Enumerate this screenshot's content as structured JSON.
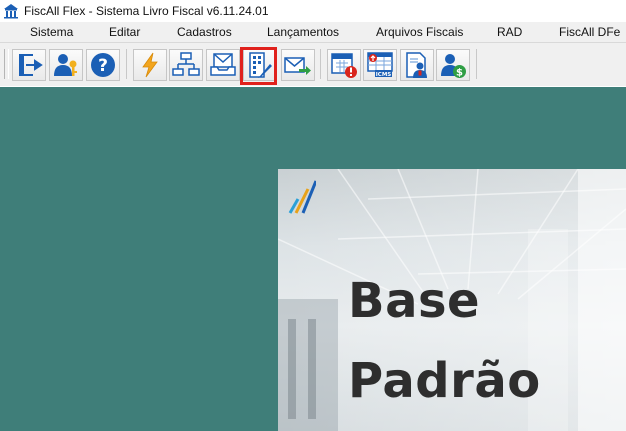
{
  "window": {
    "title": "FiscAll Flex - Sistema Livro Fiscal v6.11.24.01",
    "icon": "building-icon"
  },
  "menu": {
    "items": [
      {
        "label": "Sistema"
      },
      {
        "label": "Editar"
      },
      {
        "label": "Cadastros"
      },
      {
        "label": "Lançamentos"
      },
      {
        "label": "Arquivos Fiscais"
      },
      {
        "label": "RAD"
      },
      {
        "label": "FiscAll DFe"
      }
    ]
  },
  "toolbar": {
    "buttons": [
      {
        "icon": "exit-icon"
      },
      {
        "icon": "user-key-icon"
      },
      {
        "icon": "help-icon"
      },
      {
        "icon": "lightning-icon"
      },
      {
        "icon": "org-chart-icon"
      },
      {
        "icon": "mail-tray-icon"
      },
      {
        "icon": "building-edit-icon",
        "highlighted": true
      },
      {
        "icon": "mail-send-icon"
      },
      {
        "icon": "calendar-alert-icon"
      },
      {
        "icon": "icms-table-icon"
      },
      {
        "icon": "user-document-icon"
      },
      {
        "icon": "user-money-icon"
      }
    ]
  },
  "splash": {
    "line1": "Base",
    "line2": "Padrão"
  },
  "colors": {
    "workspace": "#3f7e79",
    "highlight": "#e0211c",
    "accent_blue": "#1b5fb5"
  }
}
